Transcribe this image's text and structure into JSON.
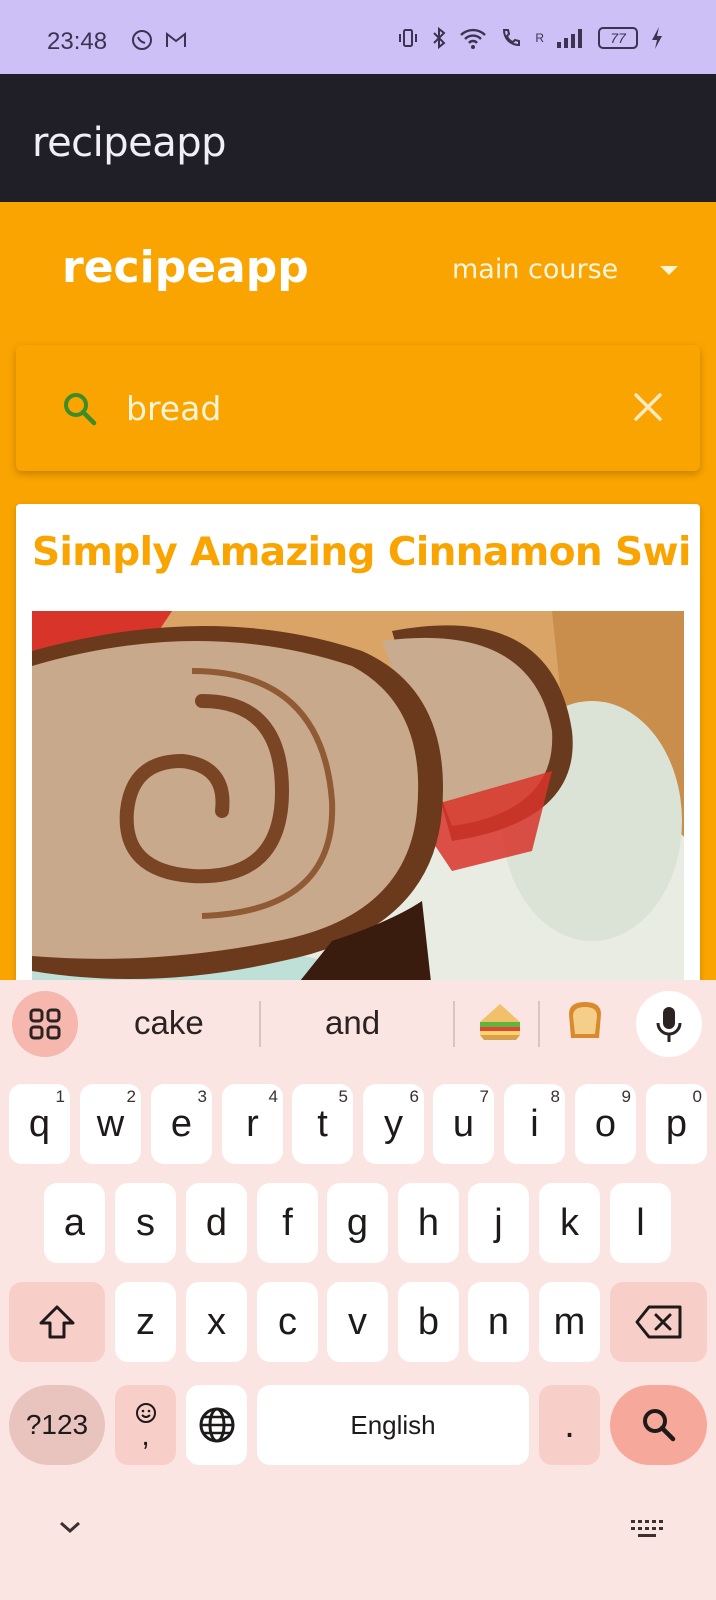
{
  "status_bar": {
    "time": "23:48",
    "battery": "77",
    "signal_label": "R",
    "icons": [
      "whatsapp-icon",
      "gmail-icon",
      "vibrate-icon",
      "bluetooth-icon",
      "wifi-icon",
      "wifi-calling-icon",
      "signal-icon",
      "battery-icon",
      "charging-icon"
    ]
  },
  "app_bar": {
    "title": "recipeapp"
  },
  "header": {
    "brand": "recipeapp",
    "category": {
      "selected": "main course",
      "icon": "caret-down-icon"
    }
  },
  "search": {
    "value": "bread",
    "search_icon": "search-icon",
    "clear_icon": "close-icon"
  },
  "card": {
    "title": "Simply Amazing Cinnamon Swir..",
    "image": "cinnamon-swirl-bread-photo"
  },
  "keyboard": {
    "suggestions": [
      "cake",
      "and"
    ],
    "emoji_suggestions": [
      "sandwich-emoji",
      "bread-emoji"
    ],
    "row1": [
      {
        "label": "q",
        "hint": "1"
      },
      {
        "label": "w",
        "hint": "2"
      },
      {
        "label": "e",
        "hint": "3"
      },
      {
        "label": "r",
        "hint": "4"
      },
      {
        "label": "t",
        "hint": "5"
      },
      {
        "label": "y",
        "hint": "6"
      },
      {
        "label": "u",
        "hint": "7"
      },
      {
        "label": "i",
        "hint": "8"
      },
      {
        "label": "o",
        "hint": "9"
      },
      {
        "label": "p",
        "hint": "0"
      }
    ],
    "row2": [
      "a",
      "s",
      "d",
      "f",
      "g",
      "h",
      "j",
      "k",
      "l"
    ],
    "row3": [
      "z",
      "x",
      "c",
      "v",
      "b",
      "n",
      "m"
    ],
    "symbols_label": "?123",
    "comma_label": ",",
    "space_label": "English",
    "period_label": ".",
    "colors": {
      "background": "#fbe5e2",
      "accent": "#f6a89b",
      "special": "#f8cfc8"
    }
  },
  "colors": {
    "primary": "#f9a400",
    "app_bar": "#201e27",
    "status_bar": "#ccc0f7",
    "card": "#ffffff"
  }
}
